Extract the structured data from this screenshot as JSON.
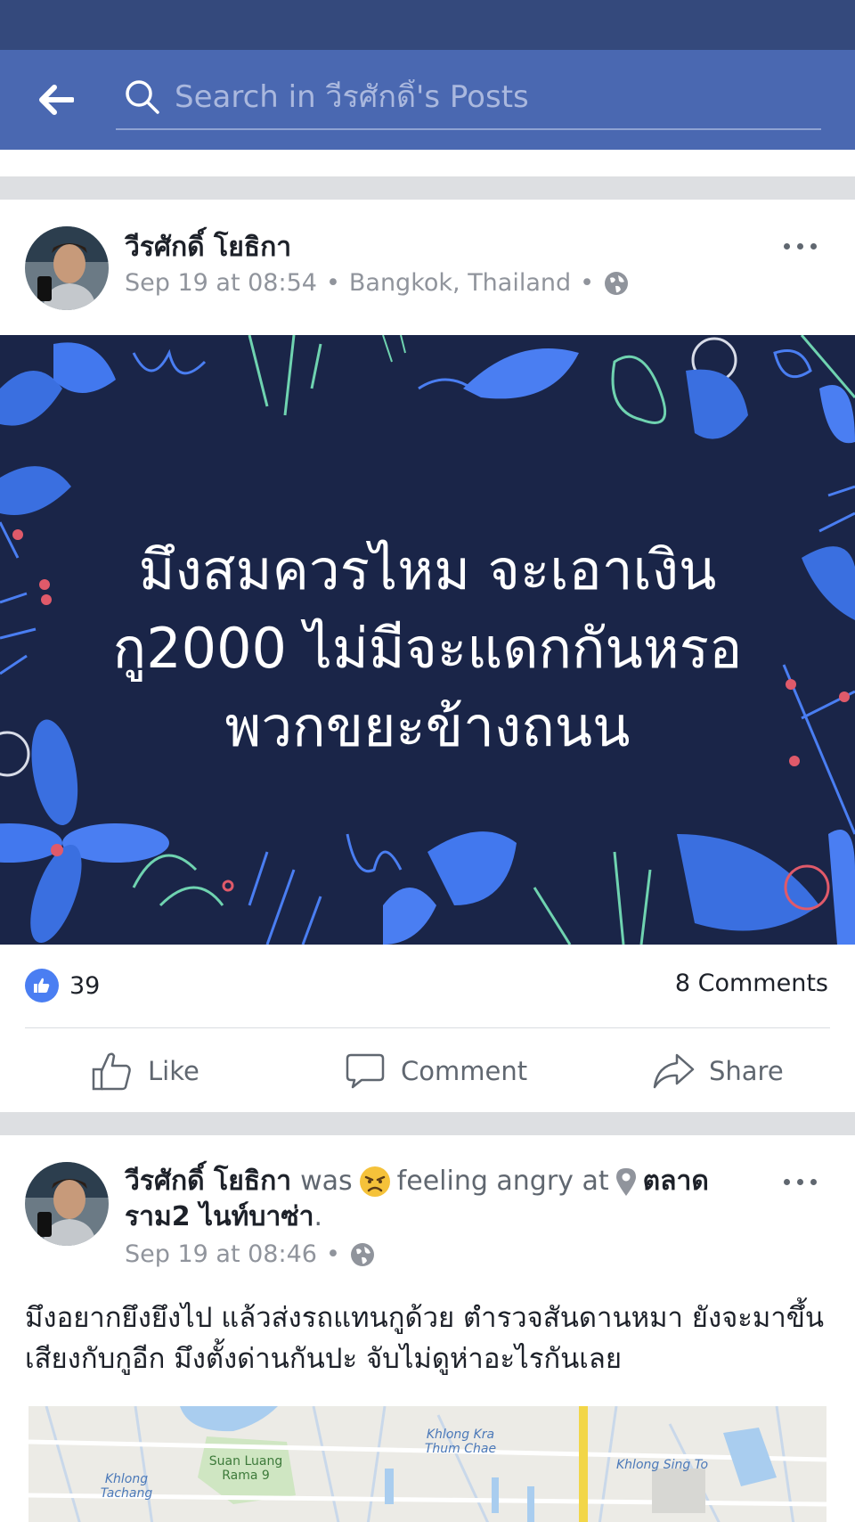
{
  "header": {
    "search_placeholder": "Search in วีรศักดิ์'s Posts"
  },
  "posts": [
    {
      "author": "วีรศักดิ์ โยธิกา",
      "time": "Sep 19 at 08:54",
      "location": "Bangkok, Thailand",
      "privacy_icon": "globe-icon",
      "text": "มึงสมควรไหม จะเอาเงิน กู2000 ไม่มีจะแดกกันหรอ พวกขยะข้างถนน",
      "text_lines": [
        "มึงสมควรไหม จะเอาเงิน",
        "กู2000 ไม่มีจะแดกกันหรอ",
        "พวกขยะข้างถนน"
      ],
      "background_color": "#1a2548",
      "likes": "39",
      "comments": "8 Comments"
    },
    {
      "author": "วีรศักดิ์ โยธิกา",
      "was": "was",
      "feeling": "feeling angry at",
      "place_line1": "ตลาด",
      "place_line2": "ราม2 ไนท์บาซ่า",
      "time": "Sep 19 at 08:46",
      "privacy_icon": "globe-icon",
      "text": "มึงอยากยึงยึงไป แล้วส่งรถแทนกูด้วย ตำรวจสันดานหมา ยังจะมาขึ้นเสียงกับกูอีก มึงตั้งด่านกันปะ จับไม่ดูห่าอะไรกันเลย",
      "map_labels": [
        "Khlong Kra Thum Chae",
        "Khlong Sing To",
        "Suan Luang Rama 9",
        "Khlong Tachang"
      ]
    }
  ],
  "actions": {
    "like": "Like",
    "comment": "Comment",
    "share": "Share"
  },
  "colors": {
    "header": "#4a68b1",
    "status_bar": "#34497c",
    "like_blue": "#4a7ef2"
  }
}
